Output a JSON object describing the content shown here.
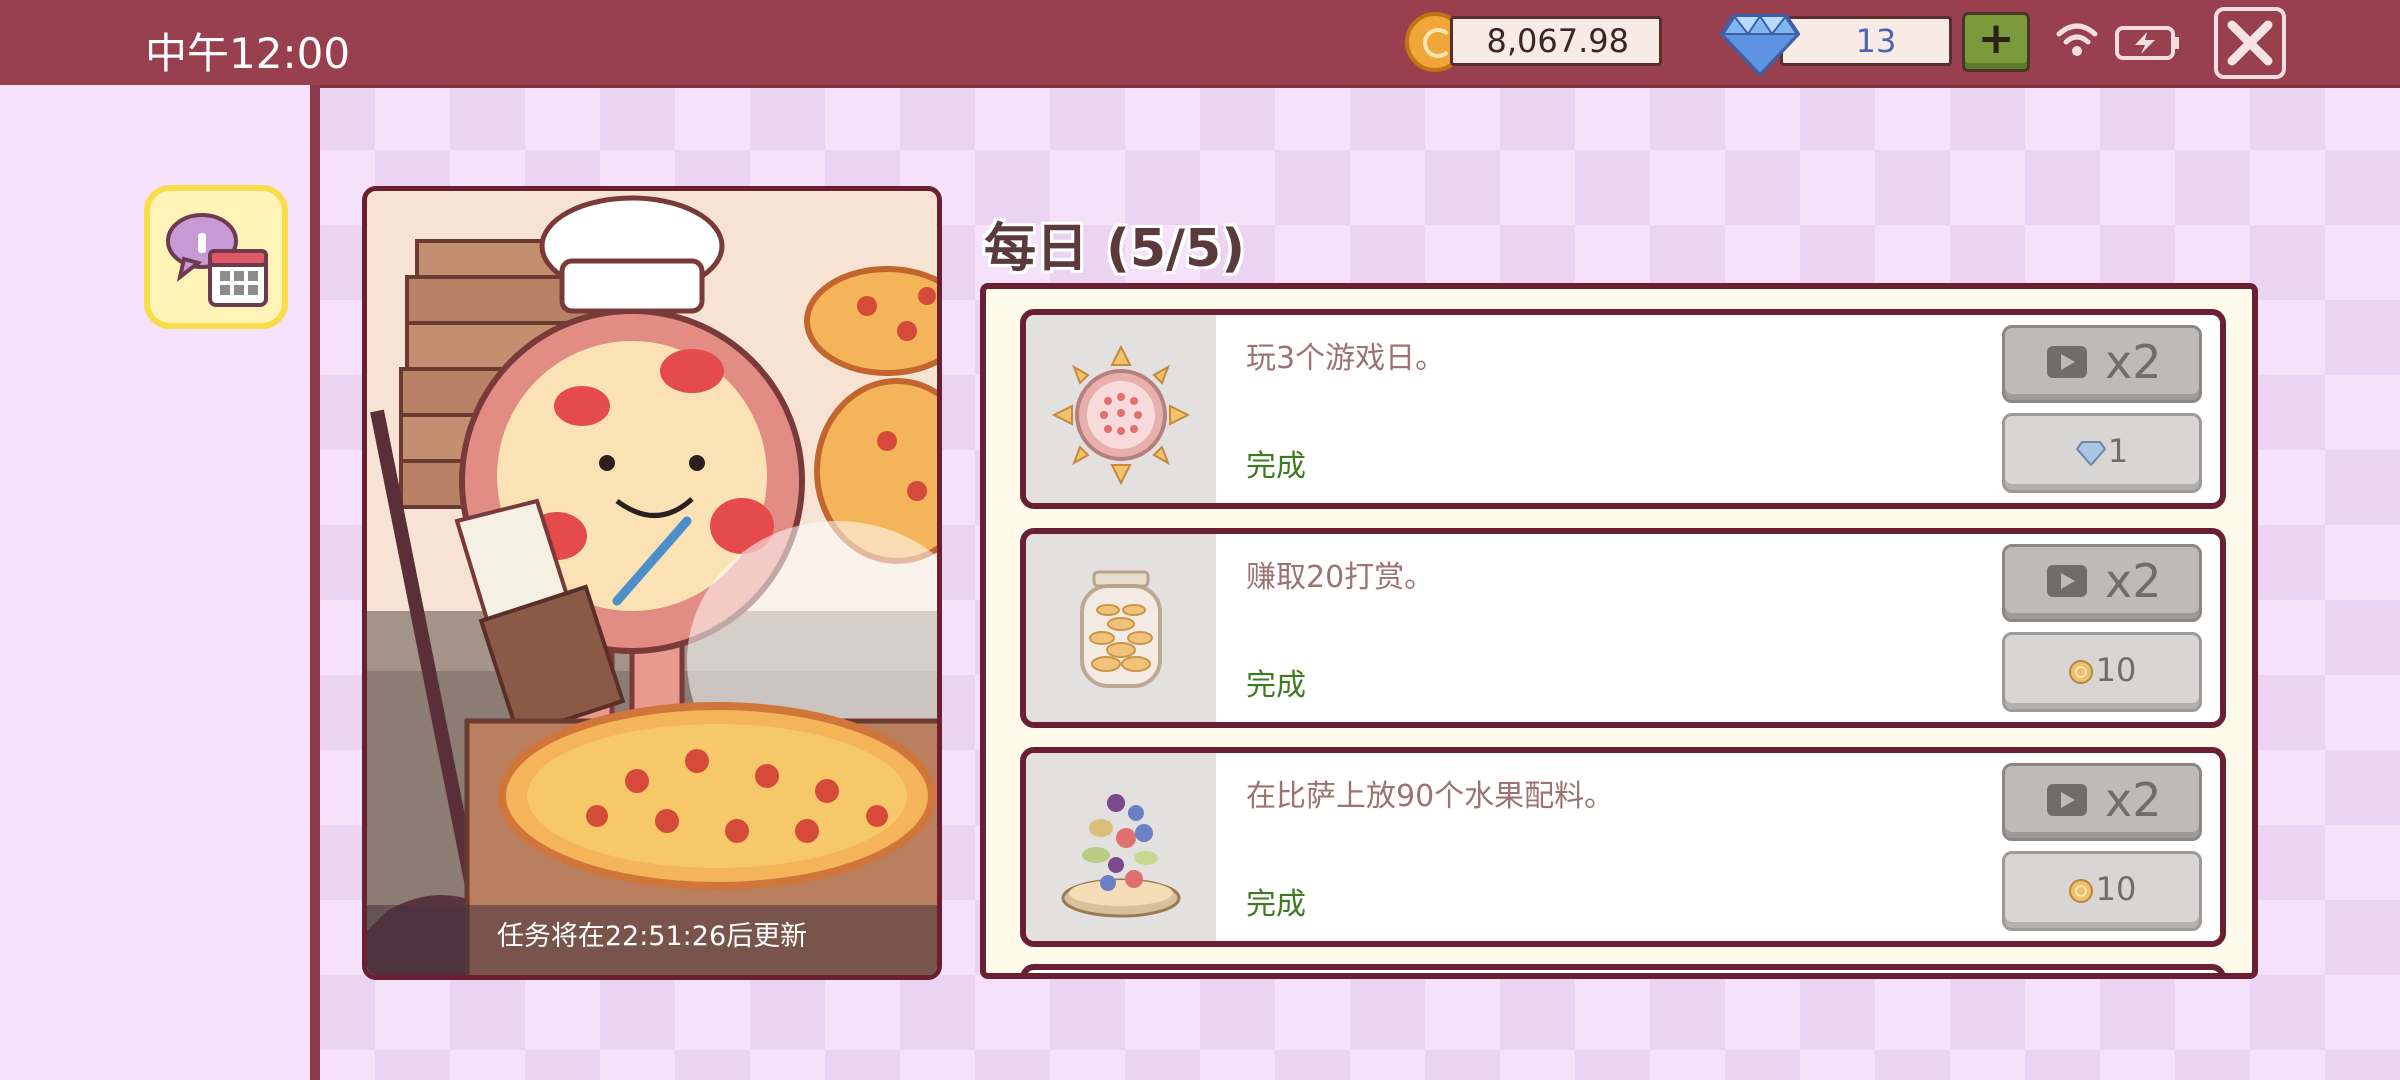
{
  "status_bar": {
    "time": "中午12:00"
  },
  "currency": {
    "coins": "8,067.98",
    "gems": "13",
    "add_label": "+"
  },
  "colors": {
    "topbar": "#98404e",
    "border": "#6a1f32",
    "complete_text": "#3f7a22"
  },
  "art_panel": {
    "refresh_text": "任务将在22:51:26后更新"
  },
  "section": {
    "title": "每日 (5/5)"
  },
  "tasks": [
    {
      "description": "玩3个游戏日。",
      "status": "完成",
      "video_multiplier": "x2",
      "reward_icon": "gem-icon",
      "reward_amount": "1"
    },
    {
      "description": "赚取20打赏。",
      "status": "完成",
      "video_multiplier": "x2",
      "reward_icon": "coin-icon",
      "reward_amount": "10"
    },
    {
      "description": "在比萨上放90个水果配料。",
      "status": "完成",
      "video_multiplier": "x2",
      "reward_icon": "coin-icon",
      "reward_amount": "10"
    }
  ]
}
